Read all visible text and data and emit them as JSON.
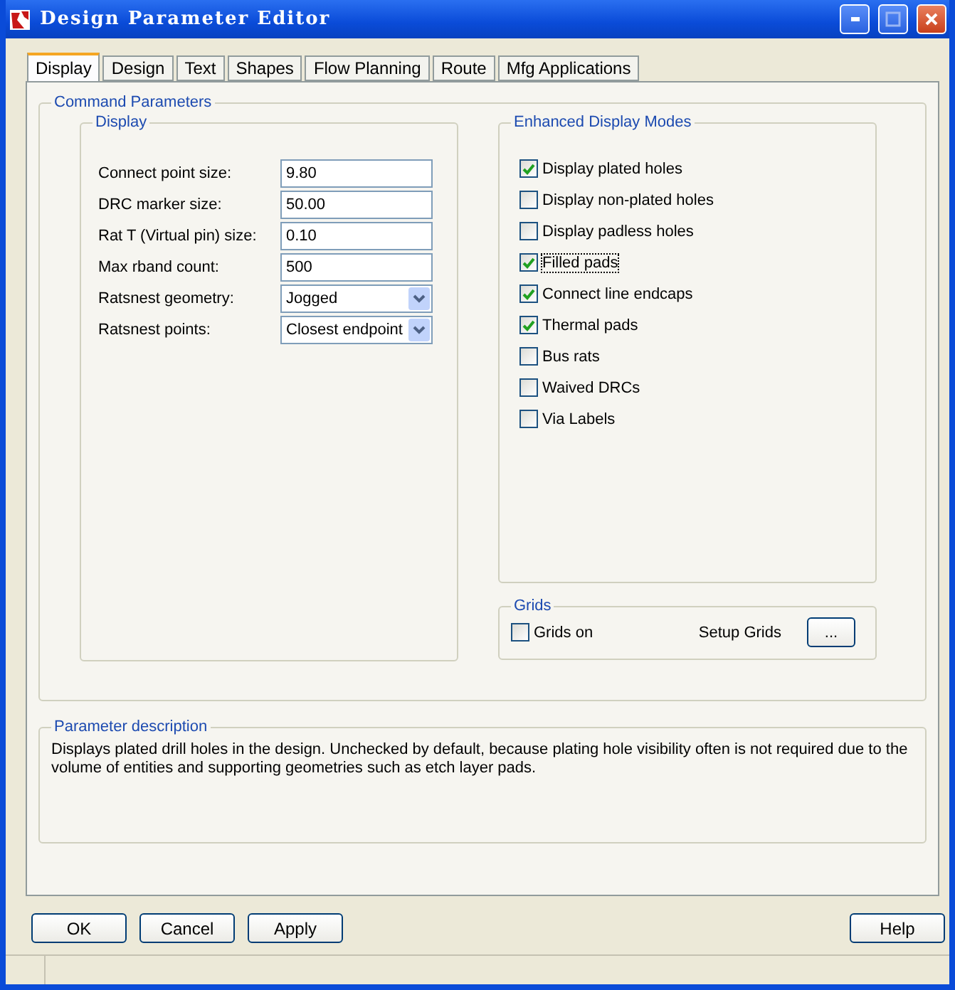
{
  "window": {
    "title": "Design Parameter Editor"
  },
  "tabs": [
    {
      "label": "Display",
      "selected": true
    },
    {
      "label": "Design",
      "selected": false
    },
    {
      "label": "Text",
      "selected": false
    },
    {
      "label": "Shapes",
      "selected": false
    },
    {
      "label": "Flow Planning",
      "selected": false
    },
    {
      "label": "Route",
      "selected": false
    },
    {
      "label": "Mfg Applications",
      "selected": false
    }
  ],
  "command_parameters": {
    "title": "Command Parameters",
    "display": {
      "title": "Display",
      "fields": [
        {
          "kind": "text",
          "label": "Connect point size:",
          "value": "9.80"
        },
        {
          "kind": "text",
          "label": "DRC marker size:",
          "value": "50.00"
        },
        {
          "kind": "text",
          "label": "Rat T (Virtual pin) size:",
          "value": "0.10"
        },
        {
          "kind": "text",
          "label": "Max rband count:",
          "value": "500"
        },
        {
          "kind": "select",
          "label": "Ratsnest geometry:",
          "value": "Jogged"
        },
        {
          "kind": "select",
          "label": "Ratsnest points:",
          "value": "Closest endpoint"
        }
      ]
    },
    "enhanced": {
      "title": "Enhanced Display Modes",
      "options": [
        {
          "label": "Display plated holes",
          "checked": true,
          "focused": false
        },
        {
          "label": "Display non-plated holes",
          "checked": false,
          "focused": false
        },
        {
          "label": "Display padless holes",
          "checked": false,
          "focused": false
        },
        {
          "label": "Filled pads",
          "checked": true,
          "focused": true
        },
        {
          "label": "Connect line endcaps",
          "checked": true,
          "focused": false
        },
        {
          "label": "Thermal pads",
          "checked": true,
          "focused": false
        },
        {
          "label": "Bus rats",
          "checked": false,
          "focused": false
        },
        {
          "label": "Waived DRCs",
          "checked": false,
          "focused": false
        },
        {
          "label": "Via Labels",
          "checked": false,
          "focused": false
        }
      ]
    },
    "grids": {
      "title": "Grids",
      "option": {
        "label": "Grids on",
        "checked": false
      },
      "setup_label": "Setup Grids",
      "setup_button": "..."
    }
  },
  "parameter_description": {
    "title": "Parameter description",
    "text": "Displays plated drill holes in the design. Unchecked by default, because plating hole visibility often is not required due to the volume of entities and supporting geometries such as etch layer pads."
  },
  "buttons": {
    "left": [
      "OK",
      "Cancel",
      "Apply"
    ],
    "right": [
      "Help"
    ]
  }
}
